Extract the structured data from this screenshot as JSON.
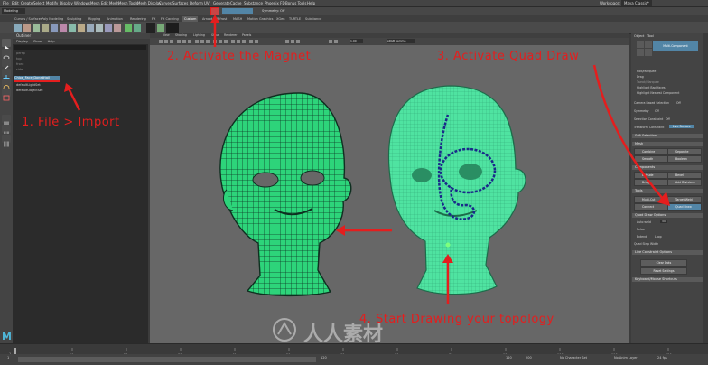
{
  "menu": [
    "File",
    "Edit",
    "Create",
    "Select",
    "Modify",
    "Display",
    "Windows",
    "Mesh",
    "Edit Mesh",
    "Mesh Tools",
    "Mesh Display",
    "Curves",
    "Surfaces",
    "Deform",
    "UV",
    "Generate",
    "Cache",
    "Substance",
    "Phoenix FD",
    "Bonus Tools",
    "Help"
  ],
  "workspace": {
    "label": "Workspace:",
    "value": "Maya Classic*"
  },
  "menuset": "Modeling",
  "shelf_tabs": [
    "Curves / Surfaces",
    "Poly Modeling",
    "Sculpting",
    "Rigging",
    "Animation",
    "Rendering",
    "FX",
    "FX Caching",
    "Custom",
    "Arnold",
    "Bifrost",
    "MASH",
    "Motion Graphics",
    "XGen",
    "TURTLE",
    "Substance"
  ],
  "shelf_active_tab": "Custom",
  "symmetry": "Symmetry: Off",
  "outliner": {
    "title": "Outliner",
    "menu": [
      "Display",
      "Show",
      "Help"
    ],
    "items": [
      "persp",
      "top",
      "front",
      "side",
      "Chloe_Face_Done#tail",
      "defaultLightSet",
      "defaultObjectSet"
    ]
  },
  "viewport": {
    "menu": [
      "View",
      "Shading",
      "Lighting",
      "Show",
      "Renderer",
      "Panels"
    ],
    "camera_value": "1.00",
    "color_space": "sRGB gamma"
  },
  "attr_panel": {
    "tabs": [
      "Object",
      "Tool"
    ],
    "title": "Multi-Component",
    "options": [
      "Pick/Marquee",
      "Drag",
      "Tweak/Marquee",
      "Highlight Backfaces",
      "Highlight Nearest Component"
    ],
    "camera_label": "Camera Based Selection",
    "camera_value": "Off",
    "symmetry_label": "Symmetry",
    "symmetry_value": "Off",
    "constraint_label": "Selection Constraint",
    "constraint_value": "Off",
    "transform_label": "Transform Constraint",
    "transform_value": "Live Surface",
    "sections": [
      "Soft Selection",
      "Mesh",
      "Components",
      "Tools",
      "Quad Draw Options",
      "Live Constraint Options",
      "Keyboard/Mouse Shortcuts"
    ],
    "mesh_buttons": [
      "Combine",
      "Separate",
      "Smooth",
      "Boolean"
    ],
    "component_buttons": [
      "Extrude",
      "Bevel",
      "Bridge",
      "Add Divisions"
    ],
    "tool_buttons": [
      "Multi-Cut",
      "Target Weld",
      "Connect",
      "Quad Draw"
    ],
    "quad_options": [
      "Auto weld",
      "Relax",
      "Extend",
      "Quad Strip Width"
    ],
    "auto_weld_value": "50",
    "extend_value": "Loop",
    "action_buttons": [
      "Clear Dots",
      "Reset Settings"
    ]
  },
  "timeline": {
    "start": "1",
    "ticks": [
      "10",
      "20",
      "30",
      "40",
      "50",
      "60",
      "70",
      "80",
      "90",
      "100",
      "110",
      "120"
    ],
    "range_start": "1",
    "range_end": "120",
    "range_end2": "120",
    "range_end3": "200",
    "character_set": "No Character Set",
    "anim_layer": "No Anim Layer",
    "fps": "24 fps"
  },
  "annotations": {
    "step1": "1. File > Import",
    "step2": "2. Activate the Magnet",
    "step3": "3. Activate Quad Draw",
    "step4": "4. Start Drawing your topology"
  },
  "watermark": "人人素材",
  "colors": {
    "annotation_red": "#e41e1e",
    "mesh_green": "#3de29b",
    "wire": "#1b4d3a",
    "viewport_bg": "#676767",
    "highlight_blue": "#5285a6"
  }
}
